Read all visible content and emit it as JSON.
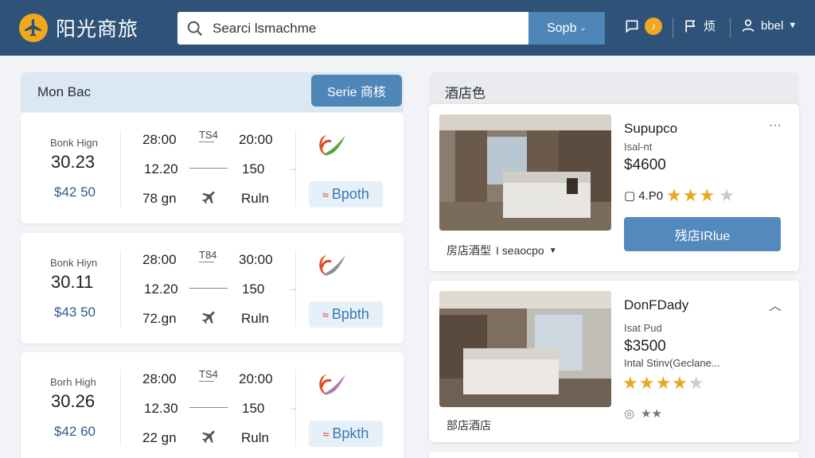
{
  "header": {
    "app_name": "阳光商旅",
    "search": {
      "value": "Searci lsmachme"
    },
    "search_button": "Sopb",
    "notifications_label": "",
    "messages_label": "烦",
    "user_label": "bbel"
  },
  "flights": {
    "title": "Mon Bac",
    "action_button": "Serie 商核",
    "items": [
      {
        "label": "Bonk Hign",
        "rate": "30.23",
        "price": "$42 50",
        "depart": "28:00",
        "depart2": "12.20",
        "duration": "78 gn",
        "stops": "TS4",
        "arrive": "20:00",
        "arrive2": "150",
        "arrive3": "Ruln",
        "book": "Bpoth"
      },
      {
        "label": "Bonk Hiyn",
        "rate": "30.11",
        "price": "$43 50",
        "depart": "28:00",
        "depart2": "12.20",
        "duration": "72.gn",
        "stops": "T84",
        "arrive": "30:00",
        "arrive2": "150",
        "arrive3": "Ruln",
        "book": "Bpbth"
      },
      {
        "label": "Borh High",
        "rate": "30.26",
        "price": "$42 60",
        "depart": "28:00",
        "depart2": "12.30",
        "duration": "22 gn",
        "stops": "TS4",
        "arrive": "20:00",
        "arrive2": "150",
        "arrive3": "Ruln",
        "book": "Bpkth"
      }
    ]
  },
  "hotels": {
    "title": "酒店色",
    "items": [
      {
        "name": "Supupco",
        "sub": "Isal-nt",
        "price": "$4600",
        "rating": "4.P0",
        "stars": "★★★",
        "half": "★",
        "button": "残店IRlue",
        "footer": "房店酒型",
        "footer_value": "I seaocpo"
      },
      {
        "name": "DonFDady",
        "sub": "Isat Pud",
        "price": "$3500",
        "desc": "Intal Stinv(Geclane...",
        "stars": "★★★★",
        "half": "★",
        "footer": "部店酒店",
        "extra": "★★"
      }
    ]
  },
  "colors": {
    "header_bg": "#2e5278",
    "accent": "#4f86b8",
    "star": "#e9a623",
    "logo": "#f0a81e"
  }
}
